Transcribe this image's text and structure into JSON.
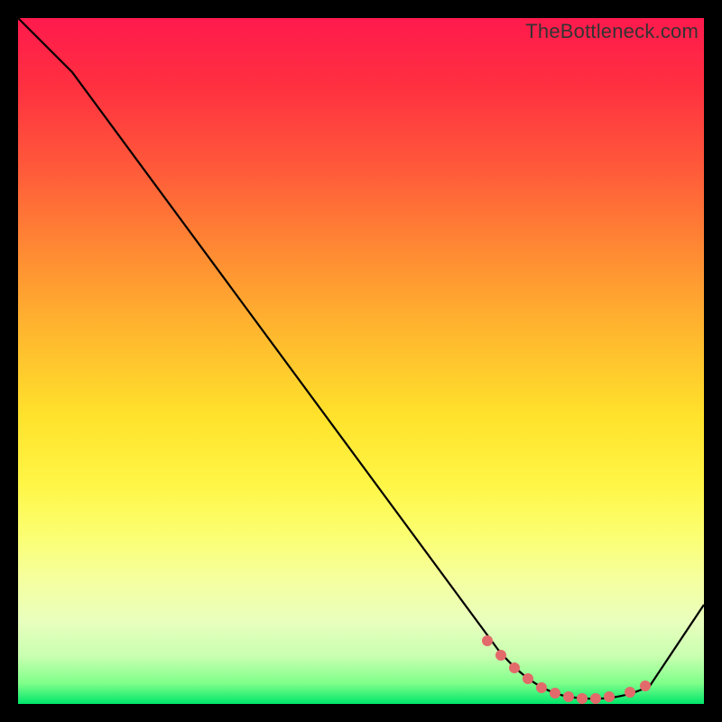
{
  "watermark": "TheBottleneck.com",
  "chart_data": {
    "type": "line",
    "title": "",
    "xlabel": "",
    "ylabel": "",
    "xlim": [
      0,
      100
    ],
    "ylim": [
      0,
      100
    ],
    "series": [
      {
        "name": "curve",
        "x": [
          0,
          8,
          70,
          75,
          80,
          85,
          90,
          95,
          100
        ],
        "y": [
          100,
          92,
          8,
          3,
          1,
          0.5,
          1,
          6,
          15
        ]
      }
    ],
    "markers": {
      "name": "highlight-dots",
      "color": "#e86a6a",
      "x": [
        70,
        72,
        74,
        76,
        78,
        80,
        82,
        84,
        86,
        90,
        92
      ],
      "y": [
        8,
        5,
        3.5,
        2.5,
        1.8,
        1.2,
        0.9,
        0.8,
        0.9,
        2,
        3.5
      ]
    },
    "gradient_stops": [
      {
        "pos": 0.0,
        "color": "#ff1a4d"
      },
      {
        "pos": 0.5,
        "color": "#ffd92b"
      },
      {
        "pos": 0.82,
        "color": "#f5ffa0"
      },
      {
        "pos": 1.0,
        "color": "#00e66b"
      }
    ]
  }
}
